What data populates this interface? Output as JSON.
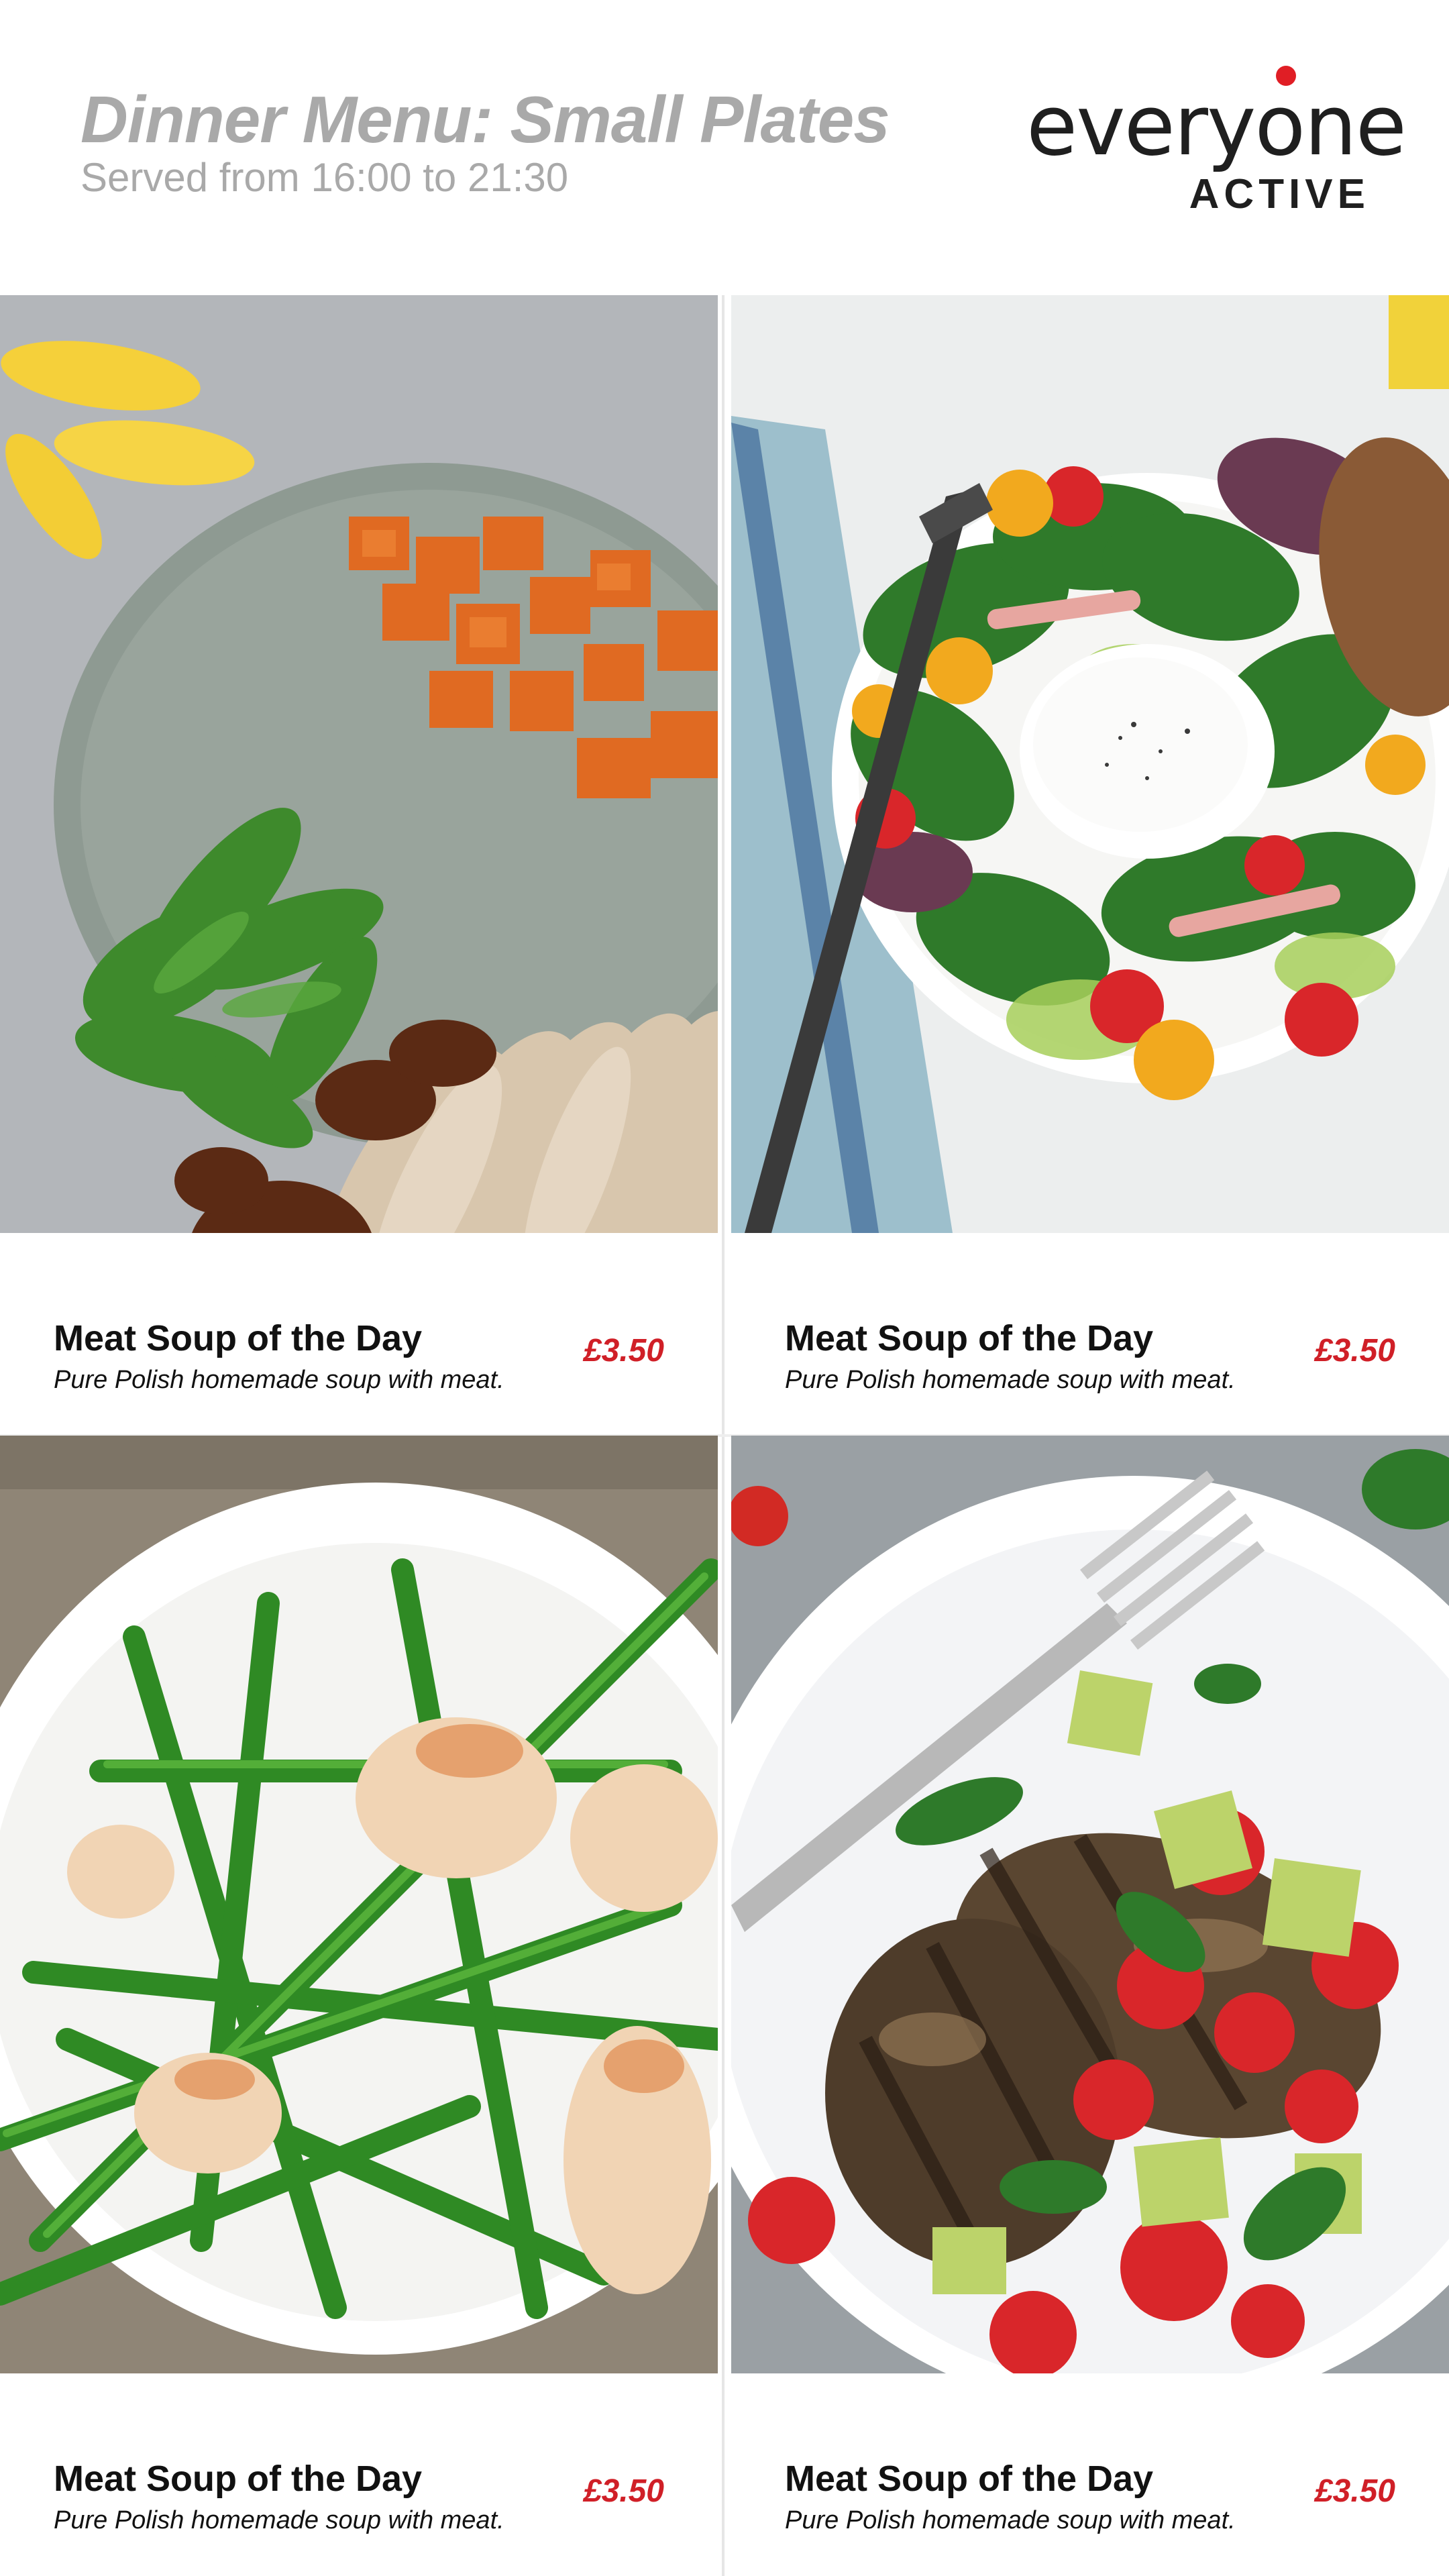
{
  "header": {
    "title": "Dinner Menu: Small Plates",
    "subtitle": "Served from 16:00 to 21:30"
  },
  "brand": {
    "name": "everyone",
    "sub": "ACTIVE",
    "accent_color": "#e01e25",
    "text_color": "#1f1f1f"
  },
  "colors": {
    "title_gray": "#a9a9a9",
    "price_red": "#d01f27"
  },
  "items": [
    {
      "name": "Meat Soup of the Day",
      "description": "Pure Polish homemade soup with meat.",
      "price": "£3.50",
      "photo": "chicken-sweet-potato-plate"
    },
    {
      "name": "Meat Soup of the Day",
      "description": "Pure Polish homemade soup with meat.",
      "price": "£3.50",
      "photo": "poached-egg-salad-bowl"
    },
    {
      "name": "Meat Soup of the Day",
      "description": "Pure Polish homemade soup with meat.",
      "price": "£3.50",
      "photo": "shrimp-asparagus-plate"
    },
    {
      "name": "Meat Soup of the Day",
      "description": "Pure Polish homemade soup with meat.",
      "price": "£3.50",
      "photo": "grilled-chicken-tomato-avocado-plate"
    }
  ]
}
